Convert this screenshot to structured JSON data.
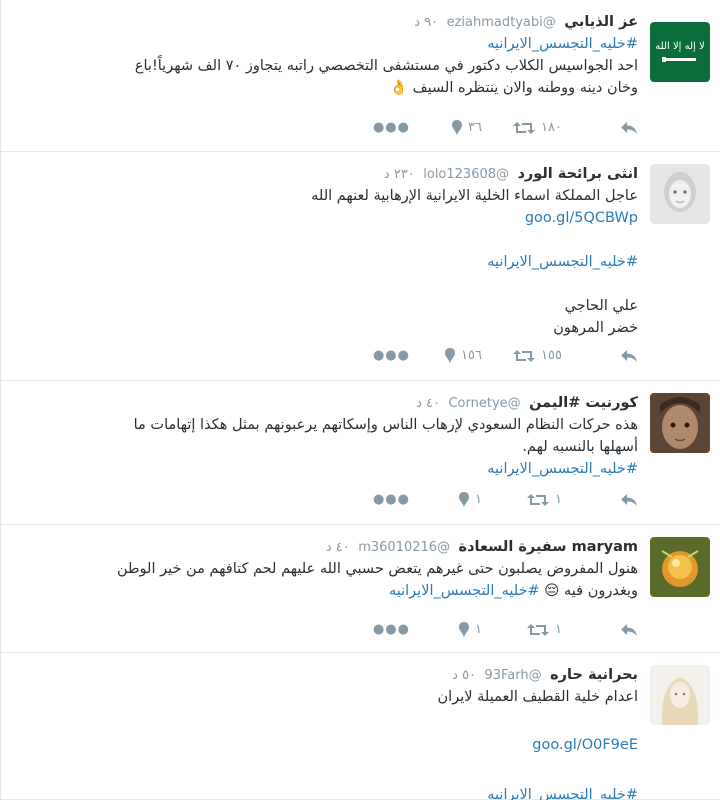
{
  "tweets": [
    {
      "name": "عز الذيابي",
      "handle": "@eziahmadtyabi",
      "time": "٩٠ د",
      "line1": "#خليه_التجسس_الايرانيه",
      "line2": "احد الجواسيس الكلاب دكتور في مستشفى التخصصي راتبه يتجاوز ٧٠ الف شهرياً!باع",
      "line3": "وخان دينه ووطنه والان ينتظره السيف 👌",
      "retweets": "١٨٠",
      "favorites": "٣٦"
    },
    {
      "name": "انثى برائحة الورد",
      "handle": "@lolo123608",
      "time": "٢٣٠ د",
      "line1": "عاجل المملكة اسماء الخلية الايرانية الإرهابية لعنهم الله",
      "link": "goo.gl/5QCBWp",
      "hashtag": "#خليه_التجسس_الايرانيه",
      "line4": "علي الحاجي",
      "line5": "خضر المرهون",
      "retweets": "١٥٥",
      "favorites": "١٥٦"
    },
    {
      "name": "كورنيت #اليمن",
      "handle": "@Cornetye",
      "time": "٤٠ د",
      "line1": "هذه حركات النظام السعودي لإرهاب الناس وإسكاتهم يرعبونهم بمثل هكذا إتهامات ما",
      "line2": "أسهلها بالنسبه لهم.",
      "hashtag": "#خليه_التجسس_الايرانيه",
      "retweets": "١",
      "favorites": "١"
    },
    {
      "name": "maryam سفيرة السعادة",
      "handle": "@m36010216",
      "time": "٤٠ د",
      "line1": "هنول المفروض يصلبون حتى غيرهم يتعض حسبي الله عليهم لحم كتافهم من خير الوطن",
      "line2": "ويغدرون فيه 😔",
      "hashtag": "#خليه_التجسس_الايرانيه",
      "retweets": "١",
      "favorites": "١"
    },
    {
      "name": "بحرانية حاره",
      "handle": "@93Farh",
      "time": "٥٠ د",
      "line1": "اعدام خلية القطيف العميلة لايران",
      "link": "goo.gl/O0F9eE",
      "hashtag": "#خليه_التجسس_الايرانيه"
    }
  ],
  "icons": {
    "reply": "reply-icon",
    "retweet": "retweet-icon",
    "favorite": "favorite-icon",
    "more": "more-icon"
  },
  "colors": {
    "link": "#2b7bb9",
    "muted": "#8899a6",
    "text": "#292f33"
  }
}
